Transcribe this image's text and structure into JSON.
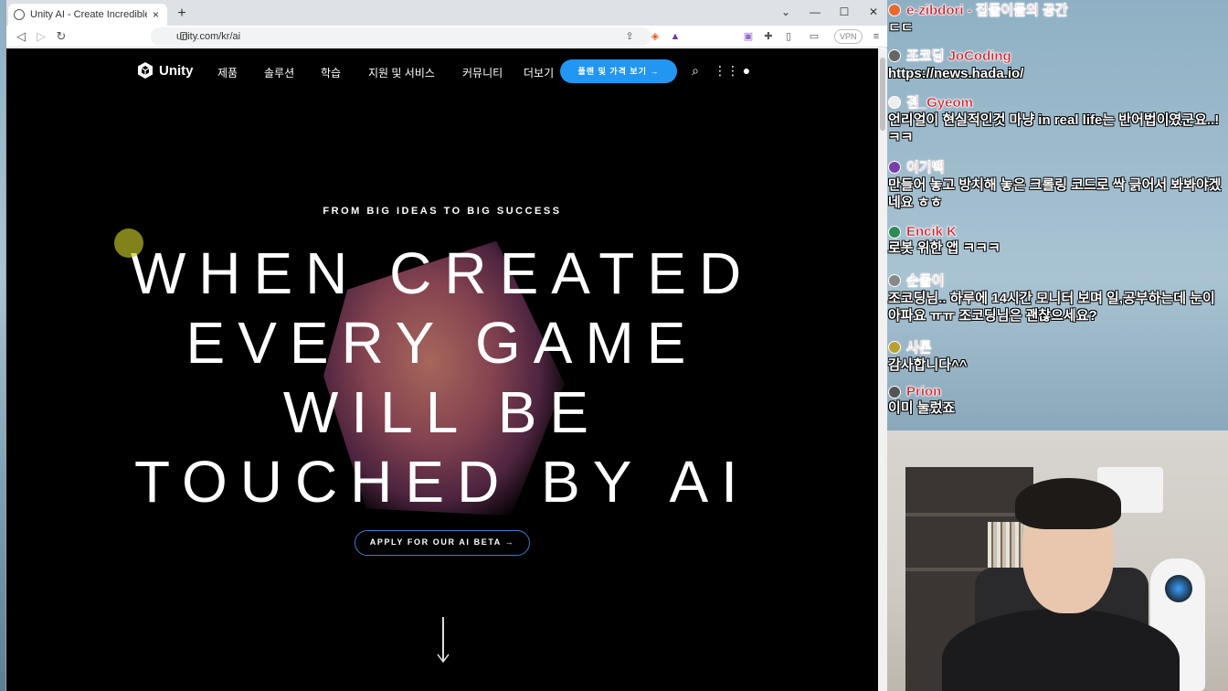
{
  "browser": {
    "tab_title": "Unity AI - Create Incredible Experiences",
    "tab_close": "×",
    "new_tab": "+",
    "url": "unity.com/kr/ai",
    "vpn_label": "VPN"
  },
  "site": {
    "logo_text": "Unity",
    "nav": [
      "제품",
      "솔루션",
      "학습",
      "지원 및 서비스",
      "커뮤니티",
      "더보기"
    ],
    "cta": "플랜 및 가격 보기 →",
    "eyebrow": "FROM BIG IDEAS TO BIG SUCCESS",
    "headline": [
      "WHEN CREATED",
      "EVERY GAME",
      "WILL BE",
      "TOUCHED BY AI"
    ],
    "apply_button": "APPLY FOR OUR AI BETA →"
  },
  "chat": [
    {
      "name": "e-zibdori - 집돌이들의 공간",
      "text": "ㄷㄷ"
    },
    {
      "name": "조코딩 JoCoding",
      "text": "https://news.hada.io/"
    },
    {
      "name": "겸_Gyeom",
      "text": "언리얼이 현실적인것 마냥 in real life는 반어법이였군요..! ㅋㅋ"
    },
    {
      "name": "이기백",
      "text": "만들어 놓고 방치해 놓은 크롤링 코드로 싹 긁어서 봐봐야겠네요 ㅎㅎ"
    },
    {
      "name": "Encik K",
      "text": "로봇 위한 앱 ㅋㅋㅋ"
    },
    {
      "name": "순돌이",
      "text": "조코딩님.. 하루에 14시간 모니터 보며 일,공부하는데 눈이 아파요 ㅠㅠ 조코딩님은 괜찮으세요?"
    },
    {
      "name": "사톤",
      "text": "감사합니다^^"
    },
    {
      "name": "Prion",
      "text": "이미 눌렀죠"
    }
  ],
  "colors": {
    "cta_blue": "#2196f3",
    "apply_border": "#3a7bd5",
    "chat_name": "#d0202a"
  }
}
